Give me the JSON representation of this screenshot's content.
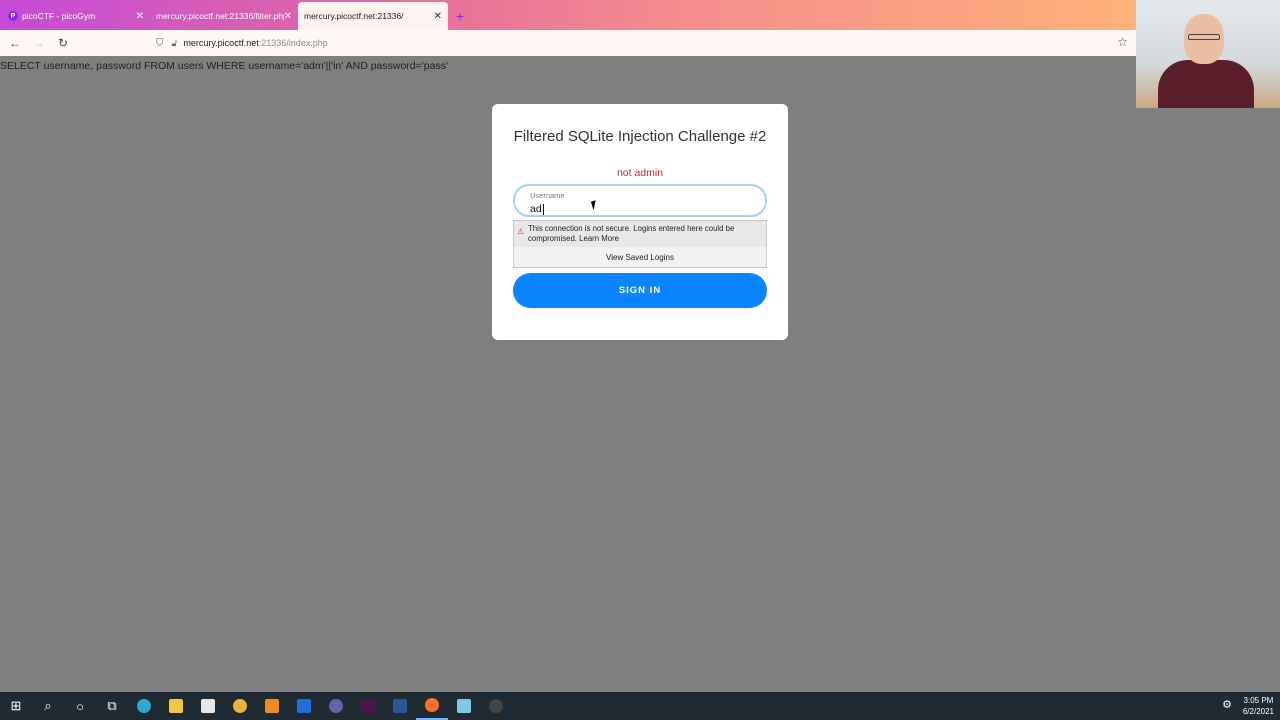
{
  "browser": {
    "tabs": [
      {
        "title": "picoCTF - picoGym",
        "favicon": "P"
      },
      {
        "title": "mercury.picoctf.net:21336/filter.php"
      },
      {
        "title": "mercury.picoctf.net:21336/"
      }
    ],
    "close_glyph": "✕",
    "new_tab_glyph": "+",
    "url": {
      "host": "mercury.picoctf.net",
      "rest": ":21336/index.php"
    },
    "back_glyph": "←",
    "forward_glyph": "→",
    "reload_glyph": "↻",
    "star_glyph": "☆"
  },
  "page": {
    "query": "SELECT username, password FROM users WHERE username='adm'||'in' AND password='pass'",
    "card_title": "Filtered SQLite Injection Challenge #2",
    "error": "not admin",
    "username_label": "Username",
    "username_value": "ad",
    "signin_label": "SIGN IN"
  },
  "autofill": {
    "warning": "This connection is not secure. Logins entered here could be compromised.",
    "learn_more": "Learn More",
    "view_saved": "View Saved Logins"
  },
  "taskbar": {
    "time": "3:05 PM",
    "date": "6/2/2021"
  },
  "colors": {
    "accent": "#0a84ff",
    "error": "#cc2222",
    "page_bg": "#7f7f7f"
  }
}
